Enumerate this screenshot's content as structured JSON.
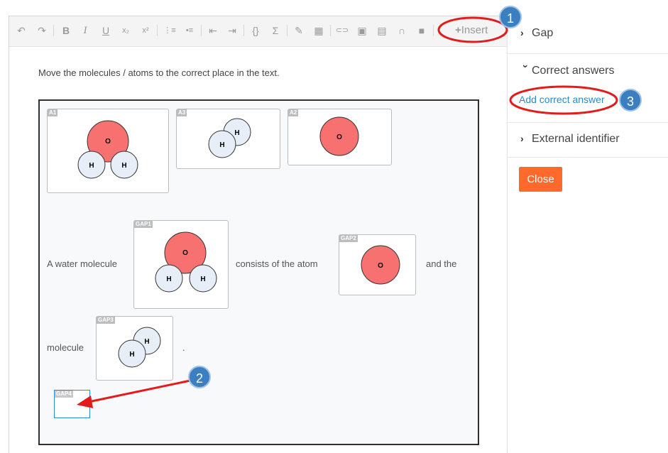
{
  "toolbar": {
    "buttons": {
      "undo": "↶",
      "redo": "↷",
      "bold": "B",
      "italic": "I",
      "underline": "U",
      "subscript": "x₂",
      "superscript": "x²",
      "ordered_list": "⋮≡",
      "bullet_list": "•≡",
      "outdent": "⇤",
      "indent": "⇥",
      "code": "{}",
      "formula": "Σ",
      "attach": "✎",
      "table": "▦",
      "link": "⊂⊃",
      "image": "▣",
      "pdf": "▤",
      "audio": "∩",
      "video": "■"
    },
    "insert_icon": "+",
    "insert_label": "Insert"
  },
  "editor": {
    "instruction": "Move the molecules / atoms to the correct place in the text."
  },
  "question": {
    "pool": [
      {
        "tag": "A1",
        "molecule": "water"
      },
      {
        "tag": "A3",
        "molecule": "hydrogen"
      },
      {
        "tag": "A2",
        "molecule": "oxygen"
      }
    ],
    "sentence": {
      "part1": "A water molecule",
      "part2": "consists of the atom",
      "part3": "and the",
      "part4": "molecule",
      "part5": "."
    },
    "gaps": [
      {
        "tag": "GAP1",
        "answer": "A1"
      },
      {
        "tag": "GAP2",
        "answer": "A2"
      },
      {
        "tag": "GAP3",
        "answer": "A3"
      },
      {
        "tag": "GAP4",
        "answer": ""
      }
    ],
    "atom_labels": {
      "oxygen": "O",
      "hydrogen": "H"
    }
  },
  "sidebar": {
    "gap": "Gap",
    "correct_answers": "Correct answers",
    "add_correct_answer": "Add correct answer",
    "external_identifier": "External identifier",
    "close": "Close"
  },
  "callouts": [
    "1",
    "2",
    "3"
  ],
  "colors": {
    "oxygen": "#f87171",
    "hydrogen": "#e8eef7",
    "accent_link": "#2b8ac9",
    "close_button": "#ff6a2c",
    "callout": "#3b7fc1",
    "highlight": "#e31b1b"
  }
}
